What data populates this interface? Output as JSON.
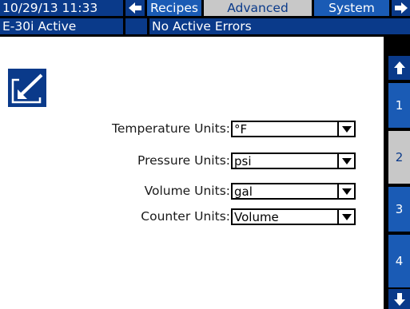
{
  "header": {
    "datetime": "10/29/13 11:33",
    "tabs": [
      {
        "label": "Recipes",
        "active": false
      },
      {
        "label": "Advanced",
        "active": true
      },
      {
        "label": "System",
        "active": false
      }
    ]
  },
  "status": {
    "machine": "E-30i Active",
    "errors": "No Active Errors"
  },
  "form": {
    "fields": [
      {
        "label": "Temperature Units:",
        "value": "°F"
      },
      {
        "label": "Pressure Units:",
        "value": "psi"
      },
      {
        "label": "Volume Units:",
        "value": "gal"
      },
      {
        "label": "Counter Units:",
        "value": "Volume"
      }
    ]
  },
  "side_nav": {
    "pages": [
      "1",
      "2",
      "3",
      "4"
    ],
    "active_page": "2"
  },
  "icons": {
    "screen_icon": "edit-arrow-icon",
    "back": "arrow-left-icon",
    "forward": "arrow-right-icon",
    "up": "arrow-up-icon",
    "down": "arrow-down-icon",
    "dropdown": "triangle-down-icon"
  },
  "colors": {
    "primary_blue": "#0a3a8a",
    "button_blue": "#1a5bb5",
    "active_grey": "#c8c8c8",
    "panel": "#ffffff"
  }
}
